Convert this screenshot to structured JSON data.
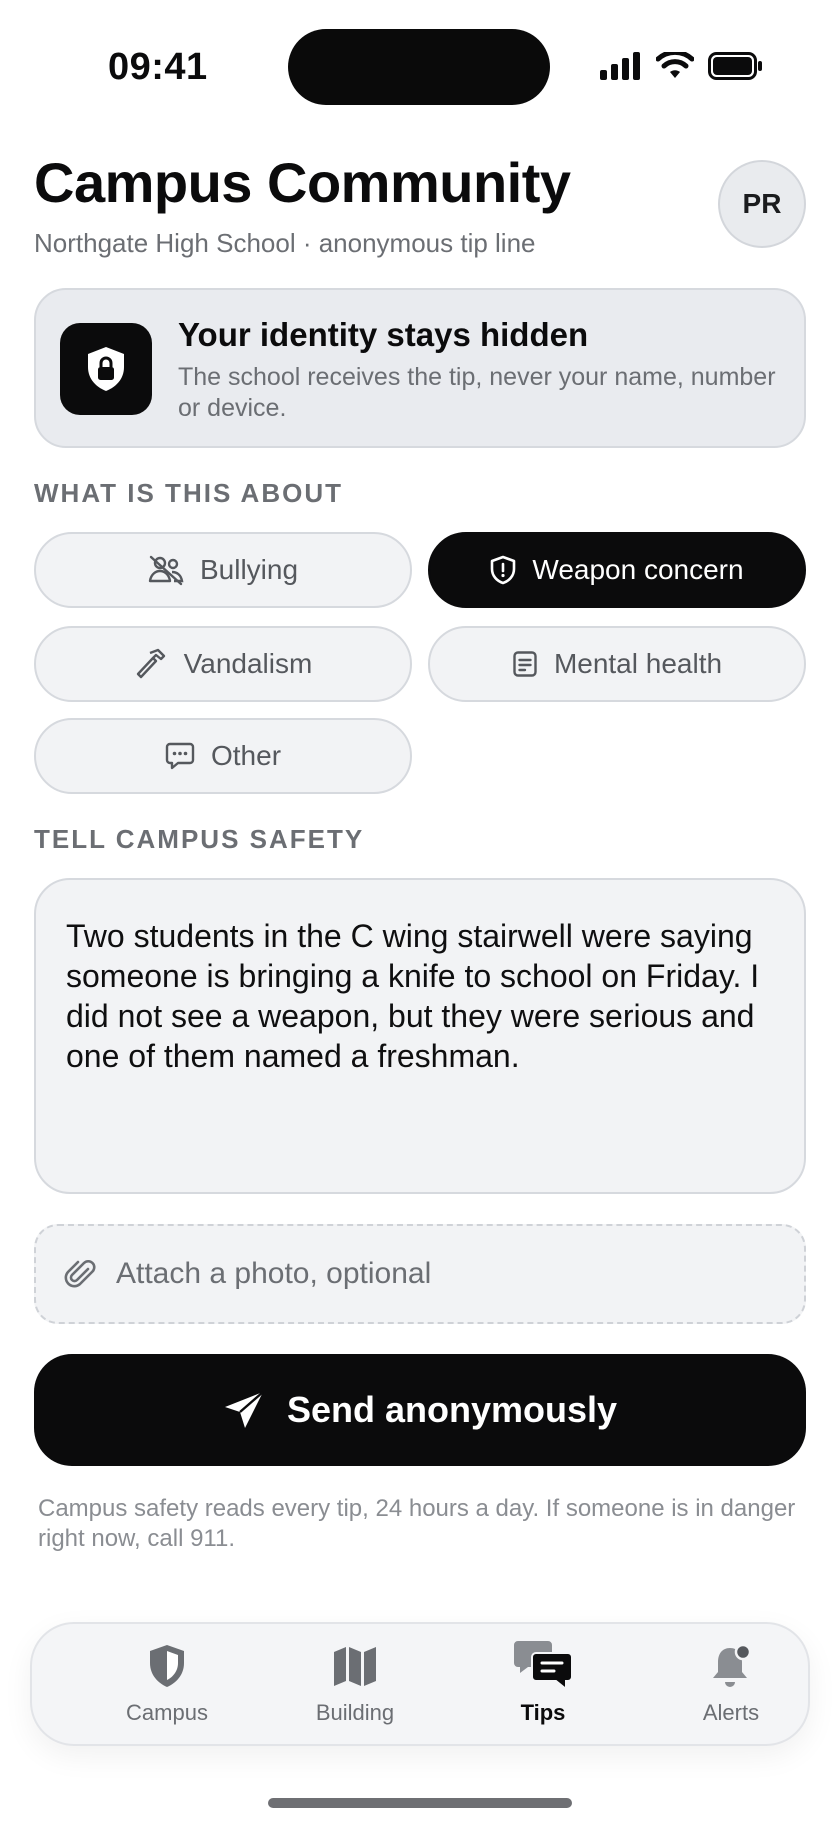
{
  "status_bar": {
    "time": "09:41"
  },
  "header": {
    "title": "Campus Community",
    "subtitle": "Northgate High School · anonymous tip line",
    "avatar_initials": "PR"
  },
  "identity_card": {
    "title": "Your identity stays hidden",
    "body": "The school receives the tip, never your name, number or device."
  },
  "category_section": {
    "label": "WHAT IS THIS ABOUT",
    "chips": [
      {
        "label": "Bullying",
        "icon": "people-off-icon",
        "selected": false
      },
      {
        "label": "Weapon concern",
        "icon": "shield-alert-icon",
        "selected": true
      },
      {
        "label": "Vandalism",
        "icon": "hammer-icon",
        "selected": false
      },
      {
        "label": "Mental health",
        "icon": "journal-icon",
        "selected": false
      },
      {
        "label": "Other",
        "icon": "chat-dots-icon",
        "selected": false
      }
    ]
  },
  "message_section": {
    "label": "TELL CAMPUS SAFETY",
    "text": "Two students in the C wing stairwell were saying someone is bringing a knife to school on Friday. I did not see a weapon, but they were serious and one of them named a freshman."
  },
  "attach": {
    "label": "Attach a photo, optional",
    "icon": "paperclip-icon"
  },
  "send_button": {
    "label": "Send anonymously",
    "icon": "send-icon"
  },
  "footnote": "Campus safety reads every tip, 24 hours a day. If someone is in danger right now, call 911.",
  "tab_bar": {
    "tabs": [
      {
        "label": "Campus",
        "icon": "shield-icon",
        "active": false
      },
      {
        "label": "Building",
        "icon": "map-icon",
        "active": false
      },
      {
        "label": "Tips",
        "icon": "chat-bubbles-icon",
        "active": true
      },
      {
        "label": "Alerts",
        "icon": "bell-icon",
        "active": false,
        "badge": true
      }
    ]
  },
  "colors": {
    "primary": "#0b0b0c",
    "surface": "#f2f3f5",
    "card": "#e9ebef",
    "muted_text": "#6b6e73"
  }
}
